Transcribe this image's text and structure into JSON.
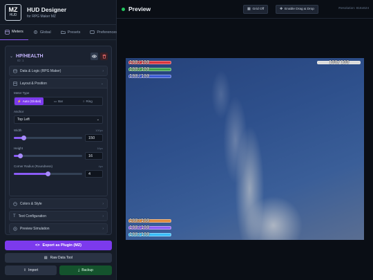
{
  "brand": {
    "logo_top": "MZ",
    "logo_bottom": "HUD",
    "title": "HUD Designer",
    "subtitle": "for RPG Maker MZ"
  },
  "tabs": [
    {
      "label": "Meters",
      "icon": "gauge-icon"
    },
    {
      "label": "Global",
      "icon": "gear-icon"
    },
    {
      "label": "Presets",
      "icon": "folder-icon"
    },
    {
      "label": "Preferences",
      "icon": "sliders-icon"
    }
  ],
  "meter": {
    "name": "HP/HEALTH",
    "id": "ID: 1"
  },
  "sections": {
    "data_logic": "Data & Logic (RPG Maker)",
    "layout": "Layout & Position",
    "colors": "Colors & Style",
    "text": "Text Configuration",
    "preview_sim": "Preview Simulation"
  },
  "layout": {
    "meter_type_label": "Meter Type",
    "types": [
      "Auto (Global)",
      "Bar",
      "Ring"
    ],
    "selected_type": "Auto (Global)",
    "anchor_label": "Anchor",
    "anchor_value": "Top Left",
    "width_label": "Width",
    "width_unit": "100px",
    "width_value": "150",
    "width_fraction": 0.15,
    "height_label": "Height",
    "height_unit": "16px",
    "height_value": "16",
    "height_fraction": 0.1,
    "radius_label": "Corner Radius (Roundness)",
    "radius_unit": "4px",
    "radius_value": "4",
    "radius_fraction": 0.5
  },
  "buttons": {
    "export": "Export as Plugin (MZ)",
    "raw": "Raw Data Tool",
    "import": "Import",
    "backup": "Backup"
  },
  "header": {
    "title": "Preview",
    "grid": "Grid Off",
    "drag": "Enable Drag & Drop",
    "resolution": "Resolution: 816x624"
  },
  "hud": {
    "top_left": [
      {
        "text": "100/100",
        "color": "#d9363e"
      },
      {
        "text": "100/100",
        "color": "#3fa34d"
      },
      {
        "text": "100/100",
        "color": "#3b5bd6"
      }
    ],
    "top_right": [
      {
        "text": "100/100",
        "color": "#d9d9d9"
      }
    ],
    "bottom_left": [
      {
        "text": "100/100",
        "color": "#e08a3c"
      },
      {
        "text": "100/100",
        "color": "#8b5cf6"
      },
      {
        "text": "100/100",
        "color": "#38bdf8"
      }
    ]
  }
}
